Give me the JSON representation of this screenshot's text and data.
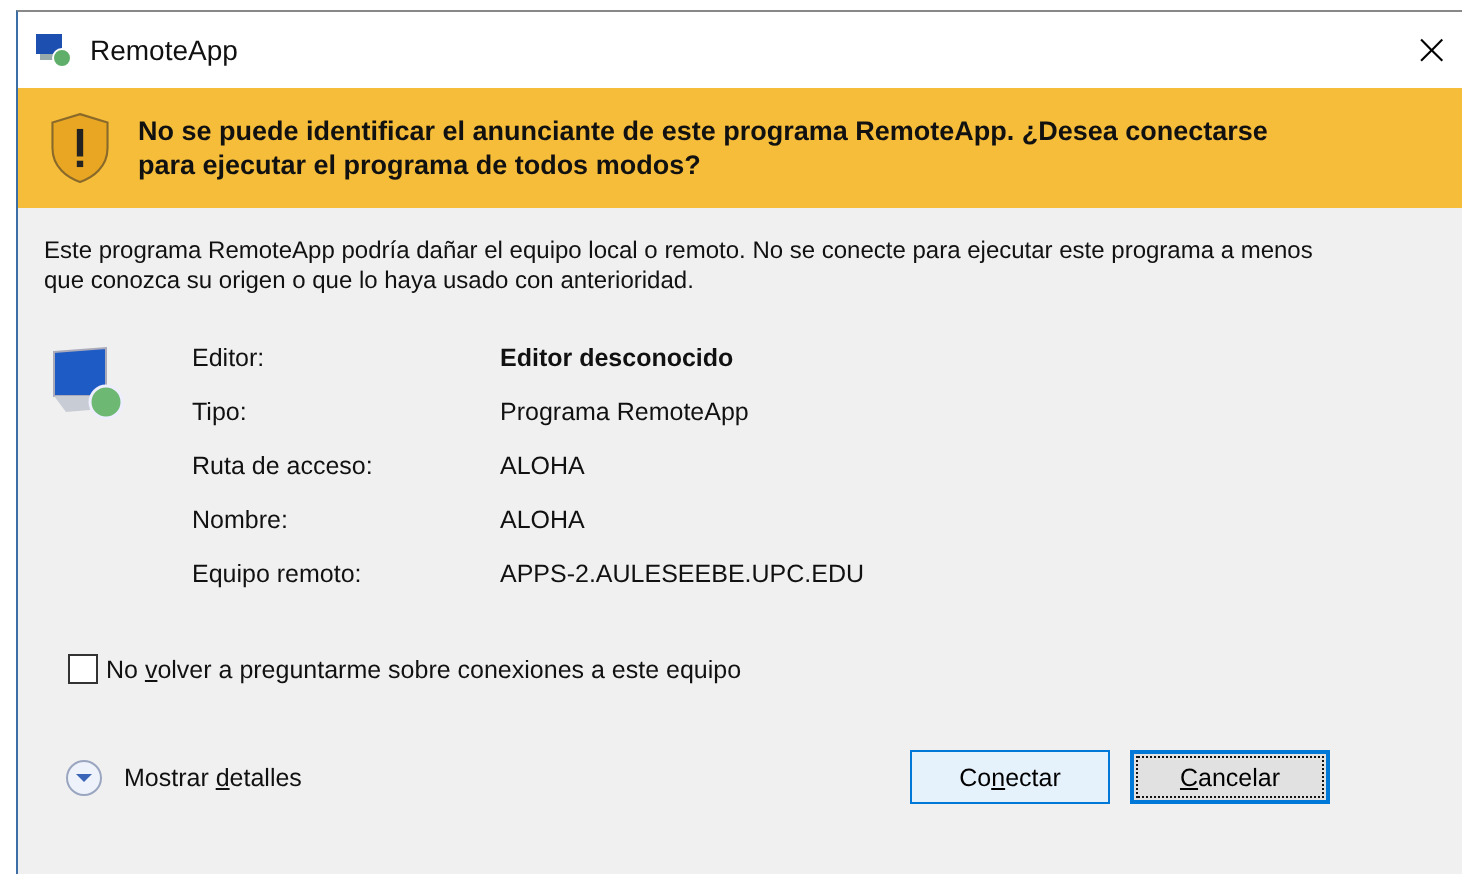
{
  "window": {
    "title": "RemoteApp",
    "close": "×"
  },
  "banner": {
    "text": "No se puede identificar el anunciante de este programa RemoteApp. ¿Desea conectarse para ejecutar el programa de todos modos?"
  },
  "description": "Este programa RemoteApp podría dañar el equipo local o remoto. No se conecte para ejecutar este programa a menos que conozca su origen o que lo haya usado con anterioridad.",
  "details": [
    {
      "label": "Editor:",
      "value": "Editor desconocido",
      "kind": "bold"
    },
    {
      "label": "Tipo:",
      "value": "Programa RemoteApp",
      "kind": "plain"
    },
    {
      "label": "Ruta de acceso:",
      "value": "ALOHA",
      "kind": "plain"
    },
    {
      "label": "Nombre:",
      "value": "ALOHA",
      "kind": "plain"
    },
    {
      "label": "Equipo remoto:",
      "value": "APPS-2.AULESEEBE.UPC.EDU",
      "kind": "plain"
    }
  ],
  "checkbox": {
    "before": "No ",
    "key": "v",
    "after": "olver a preguntarme sobre conexiones a este equipo",
    "checked": false
  },
  "toggle": {
    "before": "Mostrar ",
    "key": "d",
    "after": "etalles",
    "expanded": false
  },
  "buttons": [
    {
      "before": "Co",
      "key": "n",
      "after": "ectar",
      "selected": false
    },
    {
      "key": "C",
      "after": "ancelar",
      "selected": true
    }
  ]
}
